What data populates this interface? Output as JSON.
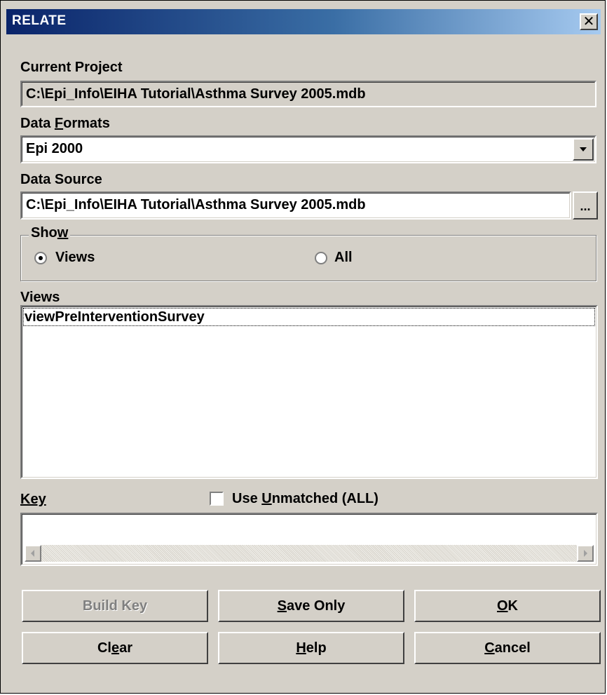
{
  "window": {
    "title": "RELATE",
    "close_glyph": "✕"
  },
  "current_project": {
    "label": "Current Project",
    "value": "C:\\Epi_Info\\EIHA Tutorial\\Asthma Survey 2005.mdb"
  },
  "data_formats": {
    "label_pre": "Data ",
    "label_mnemonic": "F",
    "label_post": "ormats",
    "selected": "Epi 2000",
    "dropdown_icon": "chevron-down-icon"
  },
  "data_source": {
    "label": "Data Source",
    "value": "C:\\Epi_Info\\EIHA Tutorial\\Asthma Survey 2005.mdb",
    "browse_label": "..."
  },
  "show": {
    "legend_pre": "Sho",
    "legend_mnemonic": "w",
    "options": [
      {
        "label": "Views",
        "selected": true
      },
      {
        "label": "All",
        "selected": false
      }
    ]
  },
  "views": {
    "label": "Views",
    "items": [
      "viewPreInterventionSurvey"
    ]
  },
  "key": {
    "label": "Key",
    "use_unmatched_pre": "Use ",
    "use_unmatched_mnemonic": "U",
    "use_unmatched_post": "nmatched (ALL)",
    "use_unmatched_checked": false
  },
  "buttons": {
    "build_key": "Build Key",
    "save_only_mnemonic": "S",
    "save_only_rest": "ave Only",
    "ok_mnemonic": "O",
    "ok_rest": "K",
    "clear_pre": "Cl",
    "clear_mnemonic": "e",
    "clear_post": "ar",
    "help_mnemonic": "H",
    "help_rest": "elp",
    "cancel_mnemonic": "C",
    "cancel_rest": "ancel"
  },
  "colors": {
    "face": "#d4d0c8",
    "title_start": "#0a246a",
    "title_end": "#a6caf0"
  }
}
